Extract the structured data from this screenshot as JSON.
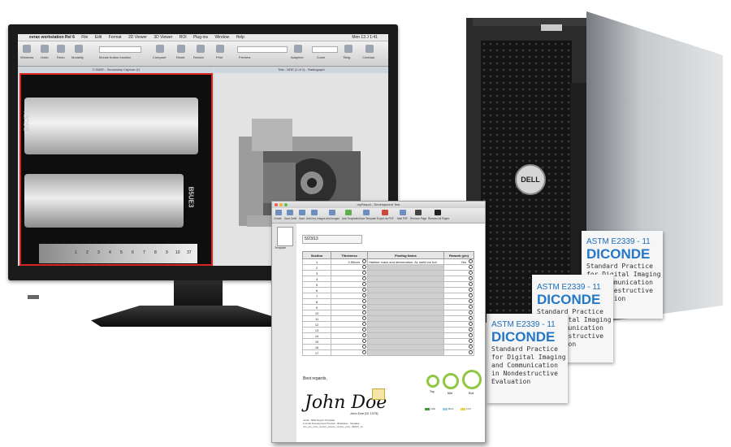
{
  "monitor": {
    "menubar": {
      "app": "evrax workstation Rel 6",
      "items": [
        "File",
        "Edit",
        "Format",
        "2D Viewer",
        "3D Viewer",
        "ROI",
        "Plug-ins",
        "Window",
        "Help"
      ],
      "clock": "Mon 13 J 1:41"
    },
    "toolbar": {
      "labels": [
        "Windows",
        "Undo",
        "Redo",
        "Modality",
        "Mouse button function",
        "Compare",
        "Reset",
        "Reslice",
        "Print",
        "Preview",
        "Adaptive",
        "Zoom",
        "Tiling",
        "Contrast"
      ]
    },
    "viewports": {
      "left_title": "C:\\NDE\\ - Secondary Capture (1)",
      "right_title": "Test - NDE (1 of 1) - Radiograph",
      "left_labels": [
        "B5UE1",
        "B5UE3"
      ],
      "step_numbers": [
        "1",
        "2",
        "3",
        "4",
        "5",
        "6",
        "7",
        "8",
        "9",
        "10",
        "37"
      ]
    }
  },
  "server": {
    "brand": "DELL"
  },
  "documents": [
    {
      "astm": "ASTM E2339 - 11",
      "title": "DICONDE",
      "body": "Standard Practice for Digital Imaging and Communication in Nondestructive Evaluation"
    },
    {
      "astm": "ASTM E2339 - 11",
      "title": "DICONDE",
      "body": "Standard Practice for Digital Imaging and Communication in Nondestructive Evaluation"
    },
    {
      "astm": "ASTM E2339 - 11",
      "title": "DICONDE",
      "body": "Standard Practice for Digital Imaging and Communication in Nondestructive Evaluation"
    }
  ],
  "report": {
    "window_title": "myReport - Development Test",
    "toolbar": [
      "Create",
      "Save Draft",
      "Save",
      "Add Key Images",
      "Add Images",
      "Add Templates",
      "Save Template",
      "Export as PDF",
      "Mail PDF",
      "Remove Page",
      "Remove All Pages"
    ],
    "thumb_label": "Template",
    "date": "5/23/13",
    "table": {
      "headers": [
        "Section",
        "Thickness",
        "Finding Notes",
        "Rework (y/n)"
      ],
      "rows": [
        {
          "section": "1",
          "thickness": "2.50mm",
          "notes": "Hairline crack and deformation. AL weld too hot",
          "rework": "Yes"
        },
        {
          "section": "2",
          "thickness": "",
          "notes": "",
          "rework": ""
        },
        {
          "section": "3",
          "thickness": "",
          "notes": "",
          "rework": ""
        },
        {
          "section": "4",
          "thickness": "",
          "notes": "",
          "rework": ""
        },
        {
          "section": "5",
          "thickness": "",
          "notes": "",
          "rework": ""
        },
        {
          "section": "6",
          "thickness": "",
          "notes": "",
          "rework": ""
        },
        {
          "section": "7",
          "thickness": "",
          "notes": "",
          "rework": ""
        },
        {
          "section": "8",
          "thickness": "",
          "notes": "",
          "rework": ""
        },
        {
          "section": "9",
          "thickness": "",
          "notes": "",
          "rework": ""
        },
        {
          "section": "10",
          "thickness": "",
          "notes": "",
          "rework": ""
        },
        {
          "section": "11",
          "thickness": "",
          "notes": "",
          "rework": ""
        },
        {
          "section": "12",
          "thickness": "",
          "notes": "",
          "rework": ""
        },
        {
          "section": "13",
          "thickness": "",
          "notes": "",
          "rework": ""
        },
        {
          "section": "14",
          "thickness": "",
          "notes": "",
          "rework": ""
        },
        {
          "section": "15",
          "thickness": "",
          "notes": "",
          "rework": ""
        },
        {
          "section": "16",
          "thickness": "",
          "notes": "",
          "rework": ""
        },
        {
          "section": "17",
          "thickness": "",
          "notes": "",
          "rework": ""
        }
      ]
    },
    "regards": "Best regards,",
    "signature": "John Doe",
    "signer": "John Doe [ID 1375]",
    "footer_lines": [
      "Jonat - NDE Report Template",
      "A Jonat Development Product - Brastislav - Slovakia",
      "xxx_xxx_xxxx_xxxxxx_xxxxxx_xxxxxx_xxxx - 80107_xx"
    ],
    "gauges": [
      "Top",
      "Mid",
      "End"
    ],
    "legend": [
      "LAB",
      "RCA",
      "LCX"
    ],
    "colors": {
      "gauge": "#8fc740",
      "legend": [
        "#3a9d3a",
        "#9ad0e8",
        "#e8d24a"
      ]
    }
  }
}
